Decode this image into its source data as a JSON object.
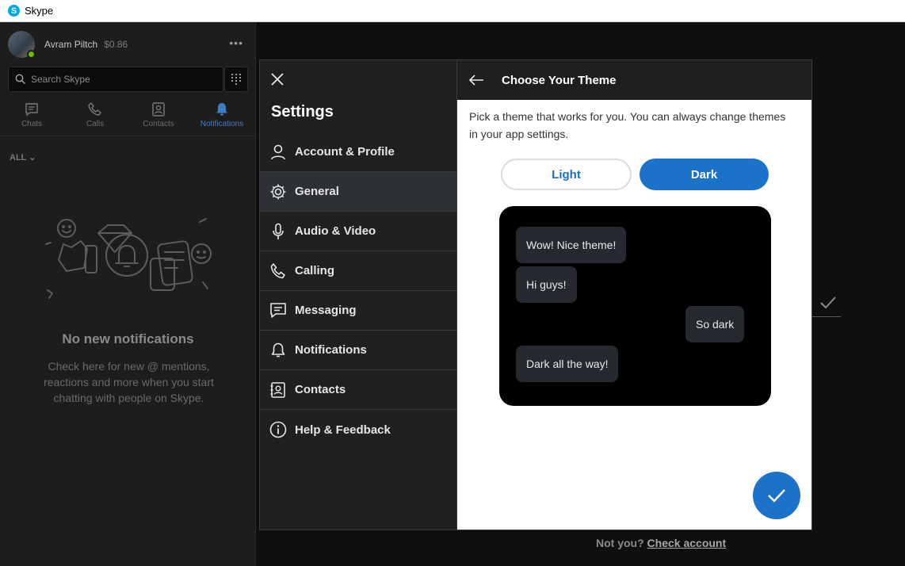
{
  "window": {
    "title": "Skype"
  },
  "profile": {
    "name": "Avram Piltch",
    "credit": "$0.86"
  },
  "search": {
    "placeholder": "Search Skype"
  },
  "nav": {
    "tabs": [
      {
        "label": "Chats",
        "icon": "chat-icon",
        "active": false
      },
      {
        "label": "Calls",
        "icon": "phone-icon",
        "active": false
      },
      {
        "label": "Contacts",
        "icon": "contacts-icon",
        "active": false
      },
      {
        "label": "Notifications",
        "icon": "bell-icon",
        "active": true
      }
    ]
  },
  "filter": {
    "label": "ALL"
  },
  "empty": {
    "title": "No new notifications",
    "text": "Check here for new @ mentions, reactions and more when you start chatting with people on Skype."
  },
  "settings": {
    "title": "Settings",
    "items": [
      {
        "label": "Account & Profile",
        "icon": "person-icon"
      },
      {
        "label": "General",
        "icon": "gear-icon",
        "active": true
      },
      {
        "label": "Audio & Video",
        "icon": "microphone-icon"
      },
      {
        "label": "Calling",
        "icon": "phone-icon"
      },
      {
        "label": "Messaging",
        "icon": "message-icon"
      },
      {
        "label": "Notifications",
        "icon": "bell-icon"
      },
      {
        "label": "Contacts",
        "icon": "contacts-icon"
      },
      {
        "label": "Help & Feedback",
        "icon": "info-icon"
      }
    ]
  },
  "theme": {
    "title": "Choose Your Theme",
    "description": "Pick a theme that works for you. You can always change themes in your app settings.",
    "options": {
      "light": "Light",
      "dark": "Dark"
    },
    "selected": "Dark",
    "preview": {
      "messages": [
        "Wow! Nice theme!",
        "Hi guys!",
        "So dark",
        "Dark all the way!"
      ]
    }
  },
  "footer": {
    "prefix": "Not you?",
    "link": "Check account"
  },
  "colors": {
    "accent": "#1b72c9",
    "background": "#0f0f0f",
    "panel": "#202020",
    "presence": "#6bb700"
  }
}
